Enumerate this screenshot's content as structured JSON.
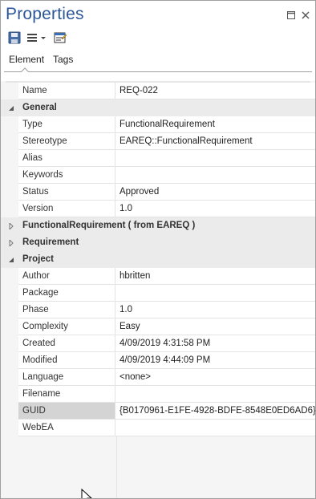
{
  "window": {
    "title": "Properties"
  },
  "toolbar": {
    "icons": [
      "save-icon",
      "menu-icon",
      "dropdown-arrow-icon",
      "properties-dialog-icon"
    ]
  },
  "tabs": [
    {
      "label": "Element",
      "active": true
    },
    {
      "label": "Tags",
      "active": false
    }
  ],
  "rows": [
    {
      "type": "prop",
      "name": "Name",
      "value": "REQ-022"
    },
    {
      "type": "group",
      "label": "General",
      "expanded": true
    },
    {
      "type": "prop",
      "name": "Type",
      "value": "FunctionalRequirement"
    },
    {
      "type": "prop",
      "name": "Stereotype",
      "value": "EAREQ::FunctionalRequirement"
    },
    {
      "type": "prop",
      "name": "Alias",
      "value": ""
    },
    {
      "type": "prop",
      "name": "Keywords",
      "value": ""
    },
    {
      "type": "prop",
      "name": "Status",
      "value": "Approved"
    },
    {
      "type": "prop",
      "name": "Version",
      "value": "1.0"
    },
    {
      "type": "group",
      "label": "FunctionalRequirement  ( from EAREQ )",
      "expanded": false
    },
    {
      "type": "group",
      "label": "Requirement",
      "expanded": false
    },
    {
      "type": "group",
      "label": "Project",
      "expanded": true
    },
    {
      "type": "prop",
      "name": "Author",
      "value": "hbritten"
    },
    {
      "type": "prop",
      "name": "Package",
      "value": ""
    },
    {
      "type": "prop",
      "name": "Phase",
      "value": "1.0"
    },
    {
      "type": "prop",
      "name": "Complexity",
      "value": "Easy"
    },
    {
      "type": "prop",
      "name": "Created",
      "value": "4/09/2019 4:31:58 PM"
    },
    {
      "type": "prop",
      "name": "Modified",
      "value": "4/09/2019 4:44:09 PM"
    },
    {
      "type": "prop",
      "name": "Language",
      "value": "<none>"
    },
    {
      "type": "prop",
      "name": "Filename",
      "value": ""
    },
    {
      "type": "prop",
      "name": "GUID",
      "value": "{B0170961-E1FE-4928-BDFE-8548E0ED6AD6}",
      "selected": true
    },
    {
      "type": "prop",
      "name": "WebEA",
      "value": ""
    }
  ],
  "colors": {
    "title": "#2b579a",
    "group_background": "#ebebeb",
    "selected_name_background": "#d4d4d4",
    "grid_lines": "#e3e3e3"
  }
}
